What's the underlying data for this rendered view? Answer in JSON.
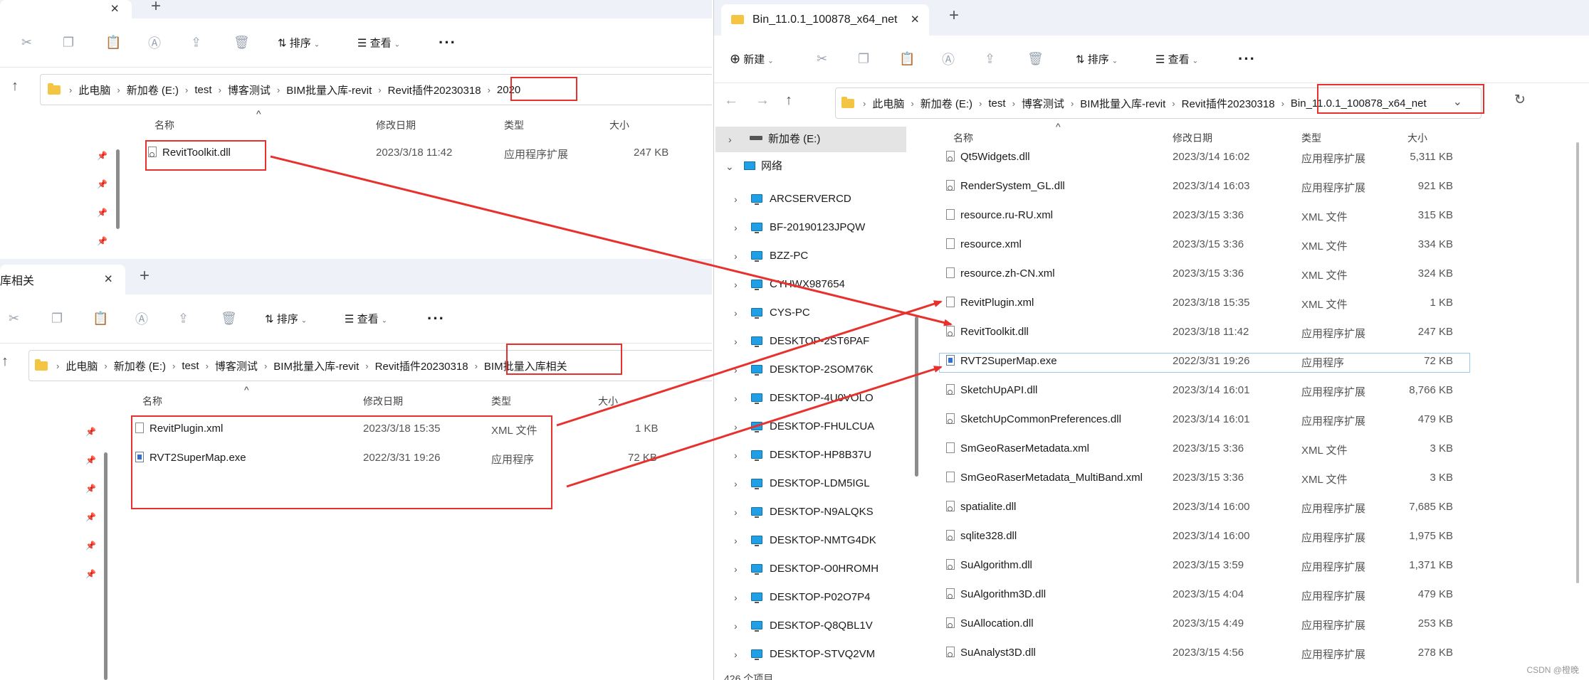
{
  "windows": {
    "top_left": {
      "tab_close": "×",
      "new_tab": "+",
      "toolbar": {
        "sort_label": "排序",
        "view_label": "查看",
        "more": "···"
      },
      "breadcrumb": [
        "此电脑",
        "新加卷 (E:)",
        "test",
        "博客测试",
        "BIM批量入库-revit",
        "Revit插件20230318",
        "2020"
      ],
      "columns": {
        "name": "名称",
        "date": "修改日期",
        "type": "类型",
        "size": "大小"
      },
      "files": [
        {
          "name": "RevitToolkit.dll",
          "date": "2023/3/18 11:42",
          "type": "应用程序扩展",
          "size": "247 KB",
          "icon": "dll"
        }
      ]
    },
    "bottom_left": {
      "tab_title": "库相关",
      "tab_close": "×",
      "new_tab": "+",
      "toolbar": {
        "sort_label": "排序",
        "view_label": "查看",
        "more": "···"
      },
      "breadcrumb": [
        "此电脑",
        "新加卷 (E:)",
        "test",
        "博客测试",
        "BIM批量入库-revit",
        "Revit插件20230318",
        "BIM批量入库相关"
      ],
      "columns": {
        "name": "名称",
        "date": "修改日期",
        "type": "类型",
        "size": "大小"
      },
      "files": [
        {
          "name": "RevitPlugin.xml",
          "date": "2023/3/18 15:35",
          "type": "XML 文件",
          "size": "1 KB",
          "icon": "file"
        },
        {
          "name": "RVT2SuperMap.exe",
          "date": "2022/3/31 19:26",
          "type": "应用程序",
          "size": "72 KB",
          "icon": "exe"
        }
      ]
    },
    "right": {
      "tab_title": "Bin_11.0.1_100878_x64_net",
      "tab_close": "×",
      "new_tab": "+",
      "toolbar": {
        "new_label": "新建",
        "sort_label": "排序",
        "view_label": "查看",
        "more": "···"
      },
      "breadcrumb": [
        "此电脑",
        "新加卷 (E:)",
        "test",
        "博客测试",
        "BIM批量入库-revit",
        "Revit插件20230318",
        "Bin_11.0.1_100878_x64_net"
      ],
      "columns": {
        "name": "名称",
        "date": "修改日期",
        "type": "类型",
        "size": "大小"
      },
      "tree": {
        "drive": "新加卷 (E:)",
        "network": "网络",
        "computers": [
          "ARCSERVERCD",
          "BF-20190123JPQW",
          "BZZ-PC",
          "CYHWX987654",
          "CYS-PC",
          "DESKTOP-2ST6PAF",
          "DESKTOP-2SOM76K",
          "DESKTOP-4U0VOLO",
          "DESKTOP-FHULCUA",
          "DESKTOP-HP8B37U",
          "DESKTOP-LDM5IGL",
          "DESKTOP-N9ALQKS",
          "DESKTOP-NMTG4DK",
          "DESKTOP-O0HROMH",
          "DESKTOP-P02O7P4",
          "DESKTOP-Q8QBL1V",
          "DESKTOP-STVQ2VM"
        ]
      },
      "files": [
        {
          "name": "Qt5Widgets.dll",
          "date": "2023/3/14 16:02",
          "type": "应用程序扩展",
          "size": "5,311 KB",
          "icon": "dll"
        },
        {
          "name": "RenderSystem_GL.dll",
          "date": "2023/3/14 16:03",
          "type": "应用程序扩展",
          "size": "921 KB",
          "icon": "dll"
        },
        {
          "name": "resource.ru-RU.xml",
          "date": "2023/3/15 3:36",
          "type": "XML 文件",
          "size": "315 KB",
          "icon": "file"
        },
        {
          "name": "resource.xml",
          "date": "2023/3/15 3:36",
          "type": "XML 文件",
          "size": "334 KB",
          "icon": "file"
        },
        {
          "name": "resource.zh-CN.xml",
          "date": "2023/3/15 3:36",
          "type": "XML 文件",
          "size": "324 KB",
          "icon": "file"
        },
        {
          "name": "RevitPlugin.xml",
          "date": "2023/3/18 15:35",
          "type": "XML 文件",
          "size": "1 KB",
          "icon": "file"
        },
        {
          "name": "RevitToolkit.dll",
          "date": "2023/3/18 11:42",
          "type": "应用程序扩展",
          "size": "247 KB",
          "icon": "dll"
        },
        {
          "name": "RVT2SuperMap.exe",
          "date": "2022/3/31 19:26",
          "type": "应用程序",
          "size": "72 KB",
          "icon": "exe"
        },
        {
          "name": "SketchUpAPI.dll",
          "date": "2023/3/14 16:01",
          "type": "应用程序扩展",
          "size": "8,766 KB",
          "icon": "dll"
        },
        {
          "name": "SketchUpCommonPreferences.dll",
          "date": "2023/3/14 16:01",
          "type": "应用程序扩展",
          "size": "479 KB",
          "icon": "dll"
        },
        {
          "name": "SmGeoRaserMetadata.xml",
          "date": "2023/3/15 3:36",
          "type": "XML 文件",
          "size": "3 KB",
          "icon": "file"
        },
        {
          "name": "SmGeoRaserMetadata_MultiBand.xml",
          "date": "2023/3/15 3:36",
          "type": "XML 文件",
          "size": "3 KB",
          "icon": "file"
        },
        {
          "name": "spatialite.dll",
          "date": "2023/3/14 16:00",
          "type": "应用程序扩展",
          "size": "7,685 KB",
          "icon": "dll"
        },
        {
          "name": "sqlite328.dll",
          "date": "2023/3/14 16:00",
          "type": "应用程序扩展",
          "size": "1,975 KB",
          "icon": "dll"
        },
        {
          "name": "SuAlgorithm.dll",
          "date": "2023/3/15 3:59",
          "type": "应用程序扩展",
          "size": "1,371 KB",
          "icon": "dll"
        },
        {
          "name": "SuAlgorithm3D.dll",
          "date": "2023/3/15 4:04",
          "type": "应用程序扩展",
          "size": "479 KB",
          "icon": "dll"
        },
        {
          "name": "SuAllocation.dll",
          "date": "2023/3/15 4:49",
          "type": "应用程序扩展",
          "size": "253 KB",
          "icon": "dll"
        },
        {
          "name": "SuAnalyst3D.dll",
          "date": "2023/3/15 4:56",
          "type": "应用程序扩展",
          "size": "278 KB",
          "icon": "dll"
        }
      ],
      "status": "426 个项目"
    }
  },
  "watermark": "CSDN @橙晚",
  "annotation_color": "#e8302c"
}
